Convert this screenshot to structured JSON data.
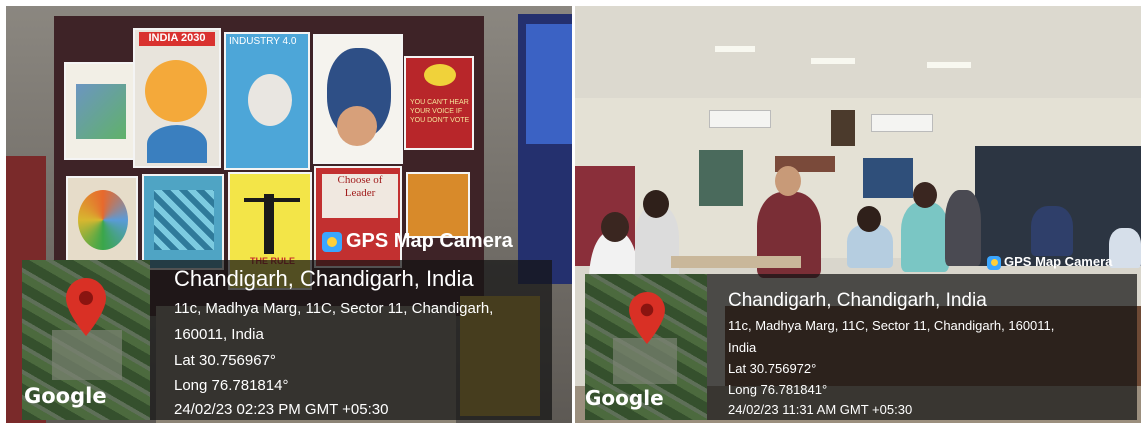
{
  "photos": [
    {
      "scene": "poster exhibition wall",
      "posters": [
        "INDIA 2030",
        "INDUSTRY 4.0",
        "",
        "YOU CAN'T HEAR YOUR VOICE IF YOU DON'T VOTE",
        "",
        "",
        "THE RULE",
        "Choose of Leader",
        ""
      ],
      "app_label": "GPS Map Camera",
      "place": "Chandigarh, Chandigarh, India",
      "address_line1": "11c, Madhya Marg, 11C, Sector 11, Chandigarh,",
      "address_line2": "160011, India",
      "lat": "Lat 30.756967°",
      "long": "Long 76.781814°",
      "datetime": "24/02/23 02:23 PM GMT +05:30",
      "map_brand": "Google"
    },
    {
      "scene": "art classroom with students",
      "app_label": "GPS Map Camera",
      "place": "Chandigarh, Chandigarh, India",
      "address_line1": "11c, Madhya Marg, 11C, Sector 11, Chandigarh, 160011,",
      "address_line2": "India",
      "lat": "Lat 30.756972°",
      "long": "Long 76.781841°",
      "datetime": "24/02/23 11:31 AM GMT +05:30",
      "map_brand": "Google"
    }
  ],
  "colors": {
    "pin": "#d93025",
    "app_icon": "#3aa6ff",
    "overlay": "#141414"
  }
}
